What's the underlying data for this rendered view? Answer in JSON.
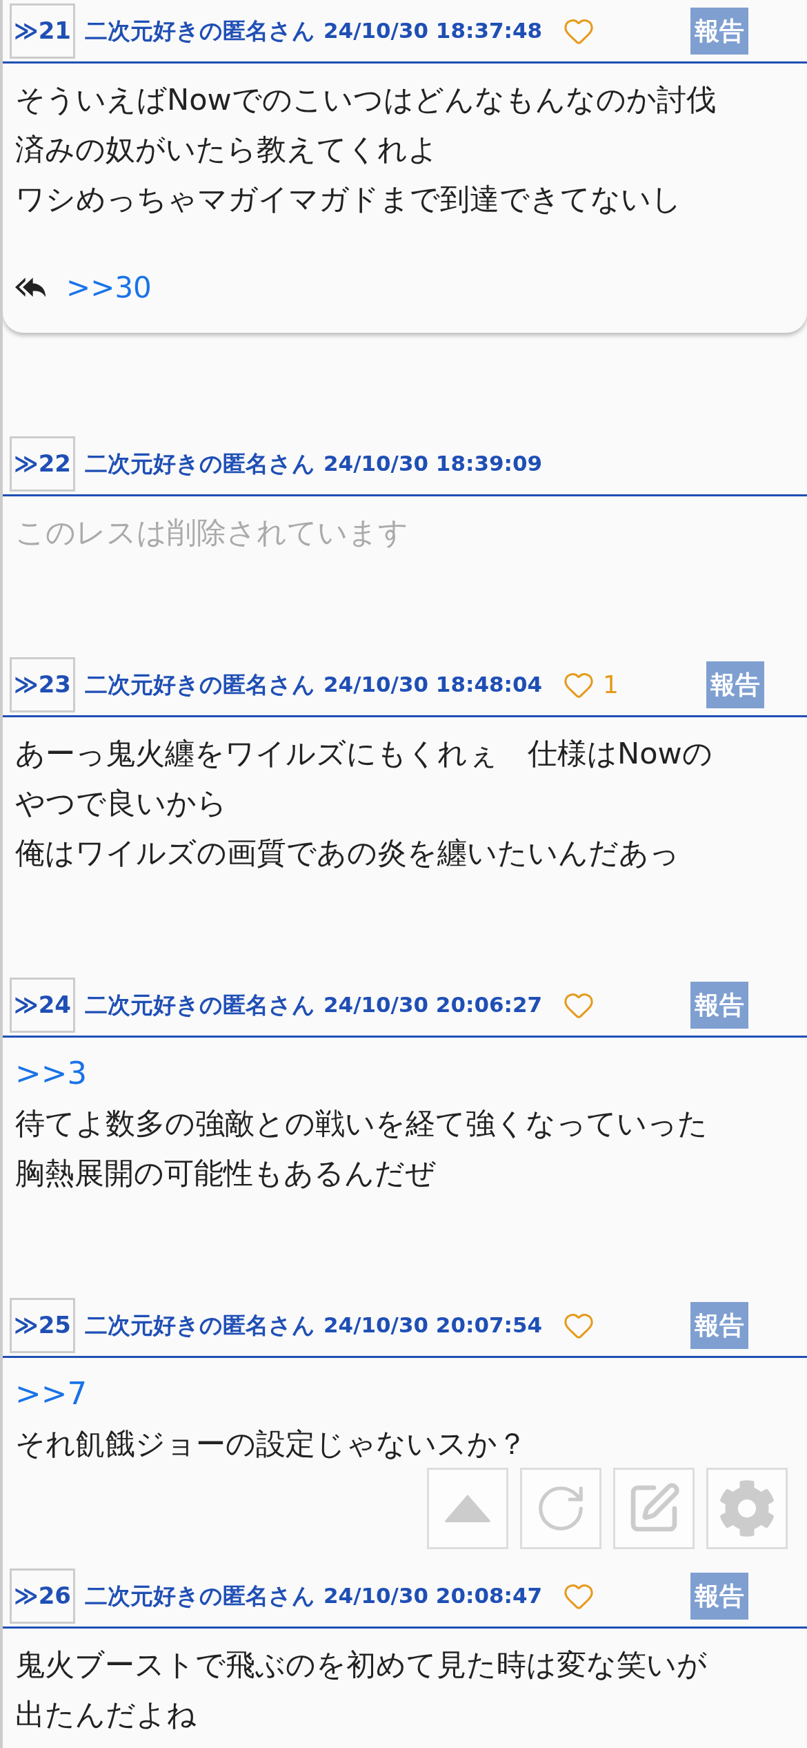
{
  "posts": [
    {
      "number": "≫21",
      "name": "二次元好きの匿名さん",
      "date": "24/10/30 18:37:48",
      "deleted": false,
      "report": "報告",
      "lines": [
        "そういえばNowでのこいつはどんなもんなのか討伐",
        "済みの奴がいたら教えてくれよ",
        "ワシめっちゃマガイマガドまで到達できてないし"
      ],
      "replies": [
        ">>30"
      ]
    },
    {
      "number": "≫22",
      "name": "二次元好きの匿名さん",
      "date": "24/10/30 18:39:09",
      "deleted": true,
      "lines": [
        "このレスは削除されています"
      ]
    },
    {
      "number": "≫23",
      "name": "二次元好きの匿名さん",
      "date": "24/10/30 18:48:04",
      "deleted": false,
      "likes": "1",
      "report": "報告",
      "lines": [
        "あーっ鬼火纏をワイルズにもくれぇ　仕様はNowの",
        "やつで良いから",
        "俺はワイルズの画質であの炎を纏いたいんだあっ"
      ]
    },
    {
      "number": "≫24",
      "name": "二次元好きの匿名さん",
      "date": "24/10/30 20:06:27",
      "deleted": false,
      "report": "報告",
      "anchor": ">>3",
      "lines": [
        "待てよ数多の強敵との戦いを経て強くなっていった",
        "胸熱展開の可能性もあるんだぜ"
      ]
    },
    {
      "number": "≫25",
      "name": "二次元好きの匿名さん",
      "date": "24/10/30 20:07:54",
      "deleted": false,
      "report": "報告",
      "anchor": ">>7",
      "lines": [
        "それ飢餓ジョーの設定じゃないスか？"
      ]
    },
    {
      "number": "≫26",
      "name": "二次元好きの匿名さん",
      "date": "24/10/30 20:08:47",
      "deleted": false,
      "report": "報告",
      "lines": [
        "鬼火ブーストで飛ぶのを初めて見た時は変な笑いが",
        "出たんだよね"
      ]
    }
  ]
}
